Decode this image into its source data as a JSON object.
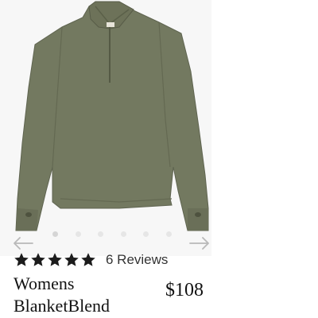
{
  "product": {
    "title_line1": "Womens",
    "title_line2": "BlanketBlend",
    "price": "$108",
    "garment_color": "#737960",
    "image_alt": "Olive green quarter-zip long sleeve pullover"
  },
  "rating": {
    "stars": 5,
    "max_stars": 5,
    "reviews_label": "6 Reviews",
    "star_color": "#1c1c1c"
  },
  "carousel": {
    "dot_count": 6,
    "active_index": 0,
    "prev_icon": "arrow-left-icon",
    "next_icon": "arrow-right-icon"
  }
}
